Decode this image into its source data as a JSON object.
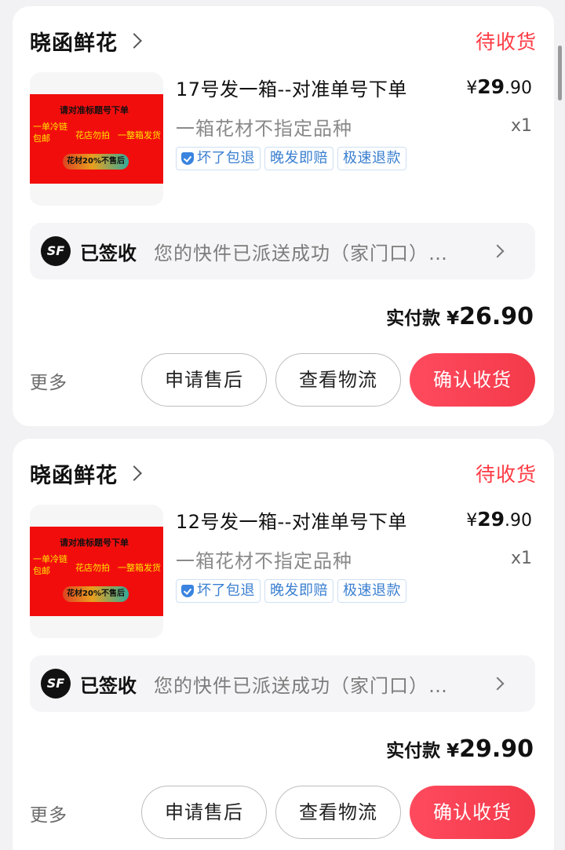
{
  "orders": [
    {
      "shop_name": "晓函鲜花",
      "status": "待收货",
      "thumb": {
        "line1": "请对准标题号下单",
        "line2": "一单冷链包邮",
        "line3": "花店勿拍",
        "line4": "一整箱发货",
        "pill": "花材20%不售后"
      },
      "title": "17号发一箱--对准单号下单",
      "price_currency": "¥",
      "price_int": "29",
      "price_dec": ".90",
      "spec": "一箱花材不指定品种",
      "qty": "x1",
      "tags": [
        "坏了包退",
        "晚发即赔",
        "极速退款"
      ],
      "logistics": {
        "status": "已签收",
        "text": "您的快件已派送成功（家门口）…"
      },
      "paid_label": "实付款",
      "paid_currency": "¥",
      "paid_amount": "26.90",
      "more": "更多",
      "buttons": {
        "after_sale": "申请售后",
        "track": "查看物流",
        "confirm": "确认收货"
      }
    },
    {
      "shop_name": "晓函鲜花",
      "status": "待收货",
      "thumb": {
        "line1": "请对准标题号下单",
        "line2": "一单冷链包邮",
        "line3": "花店勿拍",
        "line4": "一整箱发货",
        "pill": "花材20%不售后"
      },
      "title": "12号发一箱--对准单号下单",
      "price_currency": "¥",
      "price_int": "29",
      "price_dec": ".90",
      "spec": "一箱花材不指定品种",
      "qty": "x1",
      "tags": [
        "坏了包退",
        "晚发即赔",
        "极速退款"
      ],
      "logistics": {
        "status": "已签收",
        "text": "您的快件已派送成功（家门口）…"
      },
      "paid_label": "实付款",
      "paid_currency": "¥",
      "paid_amount": "29.90",
      "more": "更多",
      "buttons": {
        "after_sale": "申请售后",
        "track": "查看物流",
        "confirm": "确认收货"
      }
    }
  ],
  "icons": {
    "logistics": "sf-express-icon",
    "tag_shield": "shield-check-icon"
  },
  "colors": {
    "status": "#ff3b44",
    "primary_button": "#f33a4a",
    "tag": "#3a7fd0"
  }
}
